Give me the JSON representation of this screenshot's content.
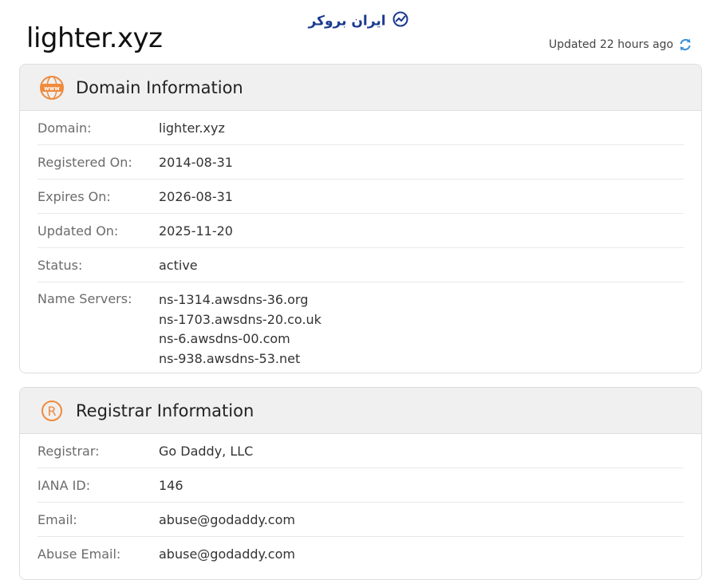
{
  "brand": {
    "name": "ایران بروکر",
    "logo_icon": "chart-trend-icon",
    "color": "#1a3a8f"
  },
  "page": {
    "title": "lighter.xyz",
    "updated_text": "Updated 22 hours ago",
    "refresh_icon": "refresh-icon",
    "accent": "#3a8fd8"
  },
  "domain_info": {
    "title": "Domain Information",
    "icon": "www-globe-icon",
    "icon_color": "#f08a3c",
    "rows": [
      {
        "label": "Domain:",
        "value": "lighter.xyz"
      },
      {
        "label": "Registered On:",
        "value": "2014-08-31"
      },
      {
        "label": "Expires On:",
        "value": "2026-08-31"
      },
      {
        "label": "Updated On:",
        "value": "2025-11-20"
      },
      {
        "label": "Status:",
        "value": "active"
      }
    ],
    "name_servers": {
      "label": "Name Servers:",
      "values": [
        "ns-1314.awsdns-36.org",
        "ns-1703.awsdns-20.co.uk",
        "ns-6.awsdns-00.com",
        "ns-938.awsdns-53.net"
      ]
    }
  },
  "registrar_info": {
    "title": "Registrar Information",
    "icon": "registered-icon",
    "icon_color": "#f08a3c",
    "rows": [
      {
        "label": "Registrar:",
        "value": "Go Daddy, LLC"
      },
      {
        "label": "IANA ID:",
        "value": "146"
      },
      {
        "label": "Email:",
        "value": "abuse@godaddy.com"
      },
      {
        "label": "Abuse Email:",
        "value": "abuse@godaddy.com"
      }
    ]
  }
}
